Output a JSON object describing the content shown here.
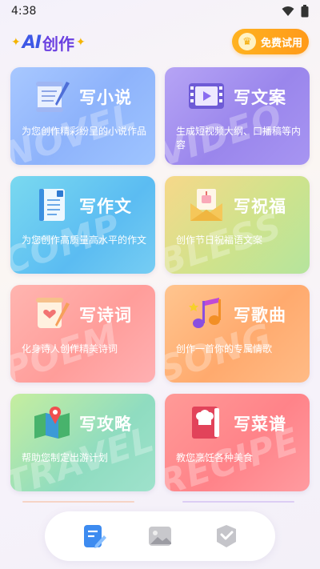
{
  "status_bar": {
    "time": "4:38"
  },
  "header": {
    "logo_ai": "AI",
    "logo_text": "创作",
    "trial_button": "免费试用"
  },
  "cards": [
    {
      "title": "写小说",
      "desc": "为您创作精彩纷呈的小说作品",
      "watermark": "NOVEL",
      "icon": "scroll-quill-icon"
    },
    {
      "title": "写文案",
      "desc": "生成短视频大纲、口播稿等内容",
      "watermark": "VIDEO",
      "icon": "film-play-icon"
    },
    {
      "title": "写作文",
      "desc": "为您创作高质量高水平的作文",
      "watermark": "COMP",
      "icon": "document-grade-icon"
    },
    {
      "title": "写祝福",
      "desc": "创作节日祝福语文案",
      "watermark": "BLESS",
      "icon": "greeting-card-icon"
    },
    {
      "title": "写诗词",
      "desc": "化身诗人创作精美诗词",
      "watermark": "POEM",
      "icon": "poem-scroll-icon"
    },
    {
      "title": "写歌曲",
      "desc": "创作一首你的专属情歌",
      "watermark": "SONG",
      "icon": "music-notes-icon"
    },
    {
      "title": "写攻略",
      "desc": "帮助您制定出游计划",
      "watermark": "TRAVEL",
      "icon": "map-pin-icon"
    },
    {
      "title": "写菜谱",
      "desc": "教您烹饪各种美食",
      "watermark": "RECIPE",
      "icon": "chef-book-icon"
    }
  ],
  "bottom_nav": [
    {
      "name": "write",
      "active": true
    },
    {
      "name": "image",
      "active": false
    },
    {
      "name": "box",
      "active": false
    }
  ]
}
